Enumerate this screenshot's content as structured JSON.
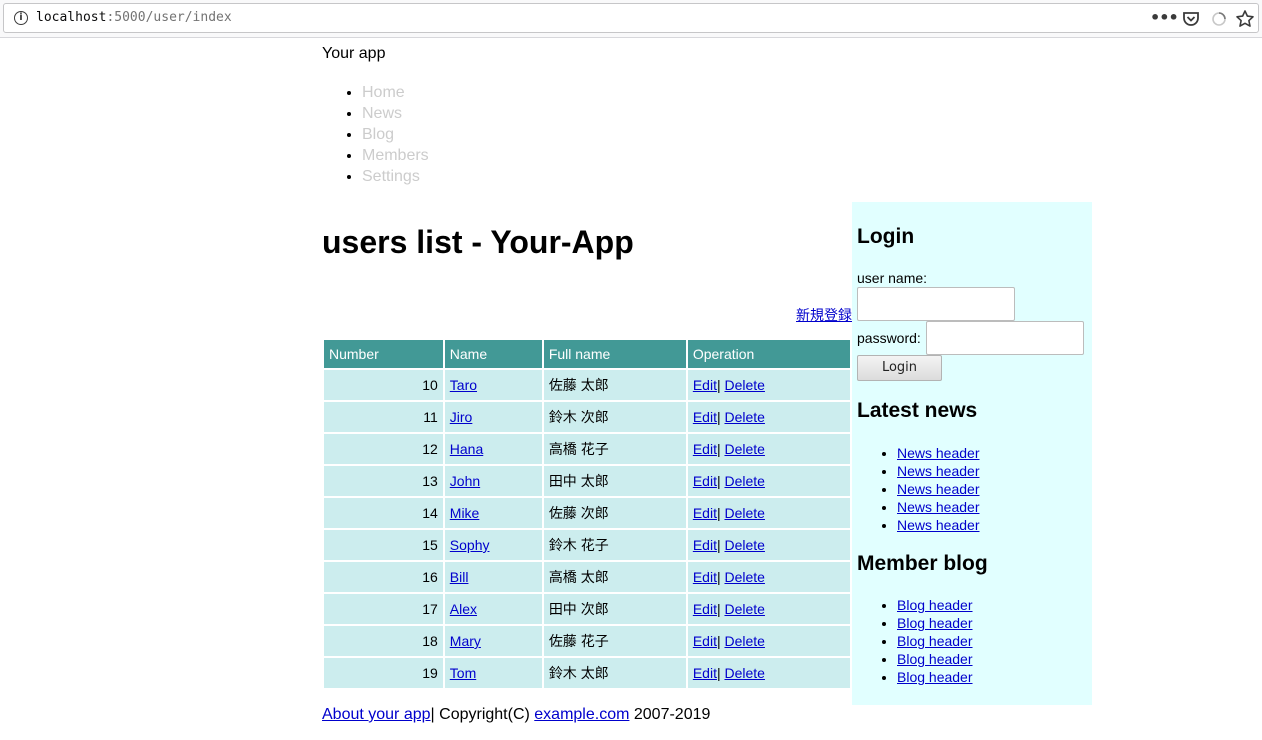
{
  "browser": {
    "url_host": "localhost",
    "url_rest": ":5000/user/index",
    "icons": [
      "info-icon",
      "more-icon",
      "pocket-icon",
      "loading-icon",
      "bookmark-star-icon"
    ]
  },
  "site": {
    "name": "Your app",
    "nav": [
      "Home",
      "News",
      "Blog",
      "Members",
      "Settings"
    ]
  },
  "main": {
    "title": "users list - Your-App",
    "new_link": "新規登録",
    "table": {
      "headers": [
        "Number",
        "Name",
        "Full name",
        "Operation"
      ],
      "rows": [
        {
          "number": "10",
          "name": "Taro",
          "full_name": "佐藤 太郎"
        },
        {
          "number": "11",
          "name": "Jiro",
          "full_name": "鈴木 次郎"
        },
        {
          "number": "12",
          "name": "Hana",
          "full_name": "高橋 花子"
        },
        {
          "number": "13",
          "name": "John",
          "full_name": "田中 太郎"
        },
        {
          "number": "14",
          "name": "Mike",
          "full_name": "佐藤 次郎"
        },
        {
          "number": "15",
          "name": "Sophy",
          "full_name": "鈴木 花子"
        },
        {
          "number": "16",
          "name": "Bill",
          "full_name": "高橋 太郎"
        },
        {
          "number": "17",
          "name": "Alex",
          "full_name": "田中 次郎"
        },
        {
          "number": "18",
          "name": "Mary",
          "full_name": "佐藤 花子"
        },
        {
          "number": "19",
          "name": "Tom",
          "full_name": "鈴木 太郎"
        }
      ],
      "edit_label": "Edit",
      "separator": "|",
      "delete_label": "Delete"
    }
  },
  "sidebar": {
    "login_heading": "Login",
    "username_label": "user name:",
    "password_label": "password:",
    "login_button": "Login",
    "news_heading": "Latest news",
    "news_items": [
      "News header",
      "News header",
      "News header",
      "News header",
      "News header"
    ],
    "blog_heading": "Member blog",
    "blog_items": [
      "Blog header",
      "Blog header",
      "Blog header",
      "Blog header",
      "Blog header"
    ]
  },
  "footer": {
    "about_link": "About your app",
    "copyright_prefix": "| Copyright(C) ",
    "site_link": "example.com",
    "years": " 2007-2019"
  },
  "colors": {
    "table_header_bg": "#429996",
    "table_cell_bg": "#ccedee",
    "sidebar_bg": "#e1ffff",
    "nav_text": "#cccccc",
    "link": "#0000cc"
  }
}
